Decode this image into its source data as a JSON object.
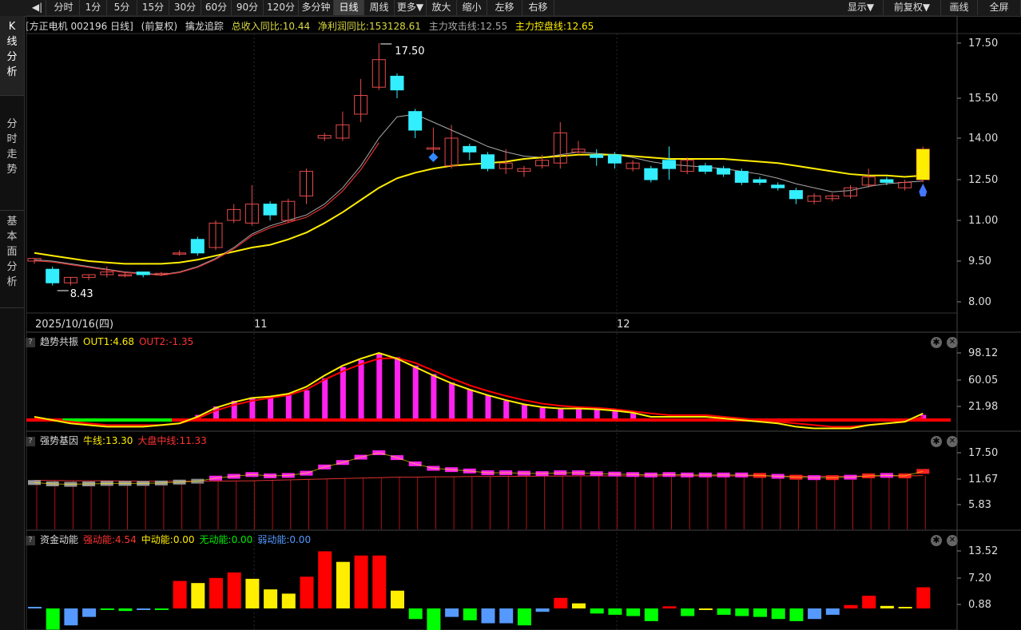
{
  "toolbar": {
    "back_icon": "back-arrow-icon",
    "items": [
      {
        "label": "分时"
      },
      {
        "label": "1分"
      },
      {
        "label": "5分"
      },
      {
        "label": "15分"
      },
      {
        "label": "30分"
      },
      {
        "label": "60分"
      },
      {
        "label": "90分"
      },
      {
        "label": "120分"
      },
      {
        "label": "多分钟"
      },
      {
        "label": "日线"
      },
      {
        "label": "周线"
      },
      {
        "label": "更多▼"
      },
      {
        "label": "放大"
      },
      {
        "label": "缩小"
      },
      {
        "label": "左移"
      },
      {
        "label": "右移"
      }
    ],
    "right_items": [
      {
        "label": "显示▼"
      },
      {
        "label": "前复权▼"
      },
      {
        "label": "画线"
      },
      {
        "label": "全屏"
      }
    ]
  },
  "leftnav": [
    {
      "label": "K线分析"
    },
    {
      "label": "分时走势"
    },
    {
      "label": "基本面分析"
    }
  ],
  "main_header": {
    "stock": "[方正电机 002196 日线]",
    "adjust": "(前复权)",
    "indicator": "擒龙追踪",
    "revenue": "总收入同比:10.44",
    "profit": "净利润同比:153128.61",
    "attack": "主力攻击线:12.55",
    "control": "主力控盘线:12.65"
  },
  "panel2_header": {
    "name": "趋势共振",
    "out1": "OUT1:4.68",
    "out2": "OUT2:-1.35"
  },
  "panel3_header": {
    "name": "强势基因",
    "bull": "牛线:13.30",
    "market": "大盘中线:11.33"
  },
  "panel4_header": {
    "name": "资金动能",
    "strong": "强动能:4.54",
    "mid": "中动能:0.00",
    "none": "无动能:0.00",
    "weak": "弱动能:0.00"
  },
  "colors": {
    "up": "#e84a4a",
    "down": "#33eeff",
    "yellow": "#ffee00",
    "magenta": "#ff22ee",
    "red": "#ff0000",
    "green": "#00ff00",
    "blue": "#5599ff",
    "gray_ma": "#aaaaaa"
  },
  "chart_data": [
    {
      "type": "candlestick",
      "ylim": [
        8.0,
        17.5
      ],
      "yticks": [
        "17.50",
        "15.50",
        "14.00",
        "12.50",
        "11.00",
        "9.50",
        "8.00"
      ],
      "xlabels": [
        {
          "i": 0,
          "label": "2025/10/16(四)"
        },
        {
          "i": 12,
          "label": "11"
        },
        {
          "i": 32,
          "label": "12"
        }
      ],
      "high_label": "17.50",
      "low_label": "8.43",
      "candles": [
        [
          9.5,
          9.6,
          9.6,
          9.4
        ],
        [
          9.2,
          8.7,
          9.3,
          8.6
        ],
        [
          8.7,
          8.9,
          8.9,
          8.6
        ],
        [
          8.9,
          9.0,
          9.0,
          8.8
        ],
        [
          9.0,
          9.1,
          9.3,
          8.9
        ],
        [
          9.0,
          9.0,
          9.1,
          8.9
        ],
        [
          9.1,
          9.0,
          9.1,
          8.9
        ],
        [
          9.0,
          9.05,
          9.1,
          8.95
        ],
        [
          9.8,
          9.8,
          9.9,
          9.7
        ],
        [
          10.3,
          9.8,
          10.4,
          9.7
        ],
        [
          10.0,
          10.9,
          11.0,
          9.9
        ],
        [
          11.0,
          11.4,
          11.6,
          10.9
        ],
        [
          10.9,
          11.6,
          12.3,
          10.8
        ],
        [
          11.6,
          11.2,
          11.7,
          11.0
        ],
        [
          11.0,
          11.7,
          11.8,
          10.9
        ],
        [
          11.9,
          12.8,
          12.9,
          11.6
        ],
        [
          14.0,
          14.1,
          14.2,
          13.9
        ],
        [
          14.0,
          14.5,
          15.0,
          13.9
        ],
        [
          14.9,
          15.6,
          16.2,
          14.6
        ],
        [
          15.9,
          16.9,
          17.5,
          15.8
        ],
        [
          16.3,
          15.8,
          16.4,
          15.5
        ],
        [
          15.0,
          14.3,
          15.1,
          14.0
        ],
        [
          13.6,
          13.65,
          14.4,
          13.3
        ],
        [
          13.0,
          14.0,
          14.5,
          12.9
        ],
        [
          13.7,
          13.5,
          13.8,
          13.2
        ],
        [
          13.4,
          12.9,
          13.5,
          12.8
        ],
        [
          12.9,
          13.1,
          13.6,
          12.7
        ],
        [
          12.8,
          12.9,
          13.0,
          12.6
        ],
        [
          13.0,
          13.2,
          13.4,
          12.9
        ],
        [
          13.1,
          14.2,
          14.6,
          12.9
        ],
        [
          13.5,
          13.6,
          13.9,
          13.4
        ],
        [
          13.4,
          13.3,
          13.6,
          13.0
        ],
        [
          13.4,
          13.1,
          13.5,
          12.9
        ],
        [
          12.9,
          13.1,
          13.2,
          12.8
        ],
        [
          12.9,
          12.5,
          13.0,
          12.4
        ],
        [
          13.2,
          12.9,
          13.7,
          12.5
        ],
        [
          12.8,
          13.2,
          13.3,
          12.7
        ],
        [
          13.0,
          12.8,
          13.1,
          12.7
        ],
        [
          12.9,
          12.7,
          13.0,
          12.6
        ],
        [
          12.8,
          12.4,
          12.9,
          12.3
        ],
        [
          12.5,
          12.4,
          12.6,
          12.3
        ],
        [
          12.3,
          12.2,
          12.4,
          12.1
        ],
        [
          12.1,
          11.8,
          12.2,
          11.6
        ],
        [
          11.7,
          11.9,
          12.0,
          11.6
        ],
        [
          11.8,
          11.9,
          12.0,
          11.7
        ],
        [
          11.9,
          12.2,
          12.3,
          11.8
        ],
        [
          12.3,
          12.6,
          12.9,
          12.2
        ],
        [
          12.5,
          12.4,
          12.6,
          12.3
        ],
        [
          12.2,
          12.4,
          12.5,
          12.1
        ],
        [
          12.5,
          13.6,
          13.7,
          12.4
        ]
      ],
      "ma_gray": [
        9.55,
        9.5,
        9.4,
        9.3,
        9.2,
        9.1,
        9.05,
        9.0,
        9.1,
        9.3,
        9.6,
        10.0,
        10.5,
        10.8,
        11.0,
        11.2,
        11.6,
        12.2,
        13.0,
        14.0,
        14.8,
        14.9,
        14.6,
        14.3,
        14.0,
        13.7,
        13.5,
        13.35,
        13.3,
        13.4,
        13.5,
        13.45,
        13.4,
        13.3,
        13.15,
        13.05,
        13.0,
        12.95,
        12.9,
        12.8,
        12.7,
        12.55,
        12.35,
        12.2,
        12.05,
        12.1,
        12.25,
        12.35,
        12.4,
        12.45
      ],
      "ma_yellow": [
        9.8,
        9.7,
        9.6,
        9.5,
        9.45,
        9.4,
        9.4,
        9.4,
        9.45,
        9.55,
        9.7,
        9.85,
        10.0,
        10.1,
        10.3,
        10.55,
        10.9,
        11.3,
        11.75,
        12.2,
        12.55,
        12.75,
        12.9,
        13.0,
        13.05,
        13.1,
        13.15,
        13.25,
        13.3,
        13.35,
        13.4,
        13.4,
        13.4,
        13.35,
        13.3,
        13.25,
        13.25,
        13.25,
        13.25,
        13.2,
        13.15,
        13.1,
        13.0,
        12.9,
        12.8,
        12.7,
        12.65,
        12.65,
        12.6,
        12.65
      ]
    },
    {
      "type": "bar",
      "yticks": [
        "98.12",
        "60.05",
        "21.98"
      ],
      "ylim": [
        5,
        103
      ],
      "bars": [
        0,
        0,
        0,
        0,
        0,
        0,
        0,
        0,
        0,
        10,
        22,
        30,
        35,
        35,
        38,
        45,
        62,
        78,
        88,
        98,
        92,
        80,
        68,
        56,
        46,
        38,
        30,
        24,
        20,
        18,
        20,
        18,
        16,
        12,
        0,
        0,
        0,
        0,
        0,
        0,
        0,
        0,
        0,
        0,
        0,
        0,
        0,
        0,
        0,
        10
      ],
      "out1": [
        10,
        8,
        6,
        5,
        4,
        4,
        4,
        5,
        6,
        10,
        20,
        28,
        34,
        36,
        40,
        50,
        66,
        80,
        90,
        98,
        90,
        78,
        66,
        55,
        46,
        38,
        31,
        25,
        21,
        19,
        19,
        18,
        16,
        13,
        10,
        10,
        10,
        10,
        9,
        8,
        7,
        6,
        4,
        3,
        3,
        3,
        5,
        6,
        7,
        12
      ],
      "out2": [
        9,
        8,
        7,
        6,
        5,
        5,
        5,
        5,
        6,
        9,
        16,
        24,
        30,
        34,
        38,
        46,
        60,
        72,
        82,
        90,
        91,
        84,
        73,
        62,
        52,
        44,
        37,
        31,
        26,
        23,
        21,
        20,
        18,
        15,
        12,
        11,
        11,
        11,
        10,
        9,
        8,
        7,
        6,
        5,
        4,
        4,
        5,
        6,
        7,
        10
      ],
      "baseline": 10,
      "green_segment": [
        2,
        7
      ]
    },
    {
      "type": "bar",
      "yticks": [
        "17.50",
        "11.67",
        "5.83"
      ],
      "ylim": [
        1.5,
        19
      ],
      "bull": [
        10.8,
        10.5,
        10.4,
        10.5,
        10.6,
        10.6,
        10.6,
        10.7,
        10.9,
        11.1,
        11.8,
        12.2,
        12.6,
        12.3,
        12.4,
        12.9,
        14.3,
        15.3,
        16.5,
        17.5,
        16.4,
        15.0,
        14.0,
        13.7,
        13.4,
        13.0,
        13.0,
        12.9,
        12.8,
        13.0,
        13.0,
        12.8,
        12.7,
        12.6,
        12.5,
        12.6,
        12.5,
        12.5,
        12.5,
        12.5,
        12.4,
        12.2,
        12.0,
        11.9,
        11.9,
        12.0,
        12.3,
        12.4,
        12.3,
        13.3
      ],
      "market": [
        11.3,
        11.25,
        11.2,
        11.2,
        11.2,
        11.15,
        11.1,
        11.1,
        11.1,
        11.1,
        11.1,
        11.15,
        11.2,
        11.3,
        11.4,
        11.5,
        11.6,
        11.7,
        11.8,
        11.9,
        12.0,
        12.0,
        12.1,
        12.1,
        12.15,
        12.15,
        12.2,
        12.2,
        12.25,
        12.25,
        12.3,
        12.3,
        12.3,
        12.3,
        12.3,
        12.3,
        12.3,
        12.3,
        12.3,
        12.3,
        12.3,
        12.25,
        12.2,
        12.2,
        12.2,
        12.2,
        12.25,
        12.3,
        12.3,
        12.35
      ]
    },
    {
      "type": "bar",
      "yticks": [
        "13.52",
        "7.20",
        "0.88"
      ],
      "ylim": [
        -6,
        16
      ],
      "values": [
        0.2,
        -5.0,
        -4.0,
        -2.0,
        -0.2,
        -0.6,
        -0.2,
        -0.3,
        6.5,
        6.0,
        7.2,
        8.5,
        7.0,
        4.5,
        3.5,
        7.5,
        13.5,
        11.0,
        12.5,
        12.5,
        4.2,
        -2.5,
        -5.5,
        -2.0,
        -2.8,
        -3.5,
        -3.5,
        -4.0,
        -0.8,
        2.5,
        1.2,
        -1.2,
        -1.5,
        -1.8,
        -3.0,
        0.5,
        -1.8,
        -0.3,
        -1.5,
        -1.8,
        -2.0,
        -2.5,
        -3.0,
        -2.5,
        -1.5,
        0.8,
        3.0,
        0.6,
        0.3,
        5.0
      ],
      "colors": [
        "blue",
        "green",
        "blue",
        "blue",
        "green",
        "green",
        "blue",
        "green",
        "red",
        "yellow",
        "red",
        "red",
        "yellow",
        "yellow",
        "yellow",
        "red",
        "red",
        "yellow",
        "red",
        "red",
        "yellow",
        "green",
        "green",
        "blue",
        "green",
        "blue",
        "blue",
        "green",
        "blue",
        "red",
        "yellow",
        "green",
        "green",
        "green",
        "green",
        "red",
        "green",
        "yellow",
        "green",
        "green",
        "green",
        "green",
        "green",
        "blue",
        "blue",
        "red",
        "red",
        "yellow",
        "yellow",
        "red"
      ]
    }
  ]
}
